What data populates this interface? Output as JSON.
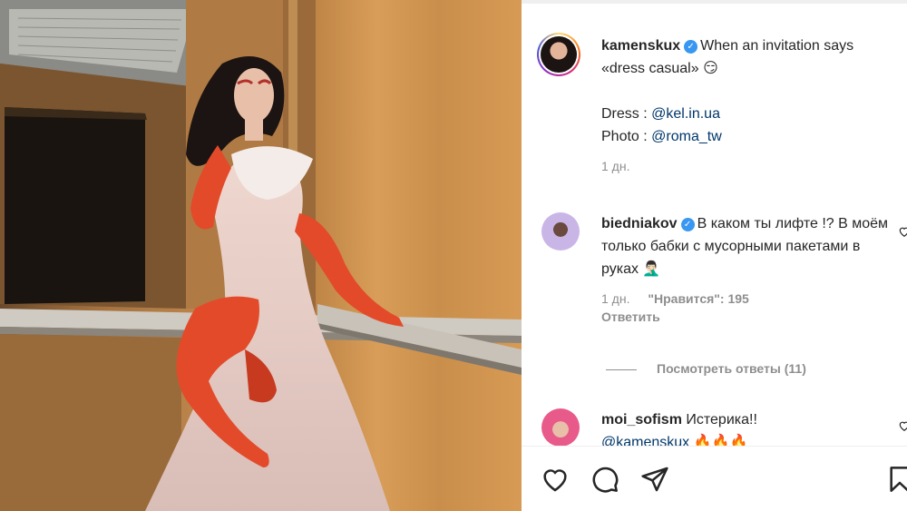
{
  "post": {
    "username": "kamenskux",
    "caption_line1": "When an invitation says",
    "caption_line2": "«dress casual» 😏",
    "dress_label": "Dress : ",
    "dress_link": "@kel.in.ua",
    "photo_label": "Photo : ",
    "photo_link": "@roma_tw",
    "time": "1 дн."
  },
  "comments": [
    {
      "username": "biedniakov",
      "text": "В каком ты лифте !? В моём только бабки с мусорными пакетами в руках 🤦🏻‍♂️",
      "time": "1 дн.",
      "likes": "\"Нравится\": 195",
      "reply_label": "Ответить",
      "view_replies": "Посмотреть ответы (11)"
    },
    {
      "username": "moi_sofism",
      "text": "Истерика!!",
      "mention": "@kamenskux 🔥🔥🔥"
    }
  ],
  "icons": {
    "verified": "verified-badge-icon",
    "like": "heart-icon",
    "comment": "comment-icon",
    "share": "paper-plane-icon",
    "save": "bookmark-icon"
  },
  "colors": {
    "verified": "#3897f0",
    "link": "#00376b",
    "meta": "#8e8e8e"
  }
}
